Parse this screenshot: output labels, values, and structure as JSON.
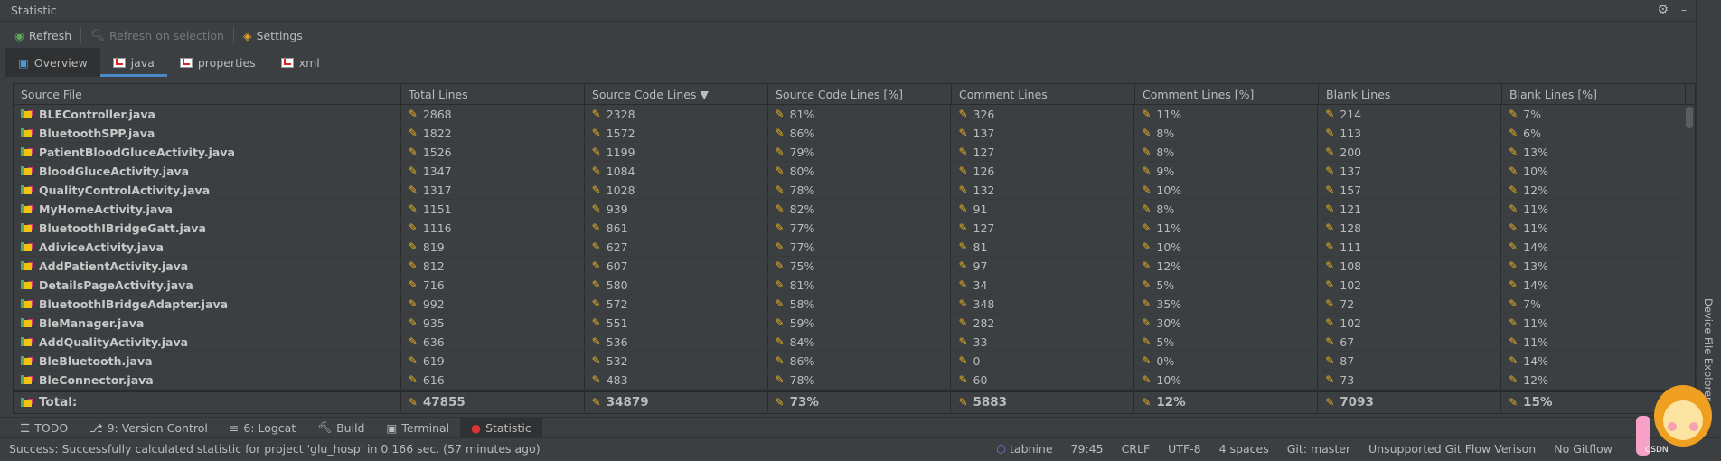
{
  "window": {
    "title": "Statistic"
  },
  "toolbar": {
    "refresh": "Refresh",
    "refresh_selection": "Refresh on selection",
    "settings": "Settings"
  },
  "tabs": [
    {
      "label": "Overview"
    },
    {
      "label": "java"
    },
    {
      "label": "properties"
    },
    {
      "label": "xml"
    }
  ],
  "table": {
    "columns": [
      "Source File",
      "Total Lines",
      "Source Code Lines ▼",
      "Source Code Lines [%]",
      "Comment Lines",
      "Comment Lines [%]",
      "Blank Lines",
      "Blank Lines [%]"
    ],
    "rows": [
      [
        "BLEController.java",
        "2868",
        "2328",
        "81%",
        "326",
        "11%",
        "214",
        "7%"
      ],
      [
        "BluetoothSPP.java",
        "1822",
        "1572",
        "86%",
        "137",
        "8%",
        "113",
        "6%"
      ],
      [
        "PatientBloodGluceActivity.java",
        "1526",
        "1199",
        "79%",
        "127",
        "8%",
        "200",
        "13%"
      ],
      [
        "BloodGluceActivity.java",
        "1347",
        "1084",
        "80%",
        "126",
        "9%",
        "137",
        "10%"
      ],
      [
        "QualityControlActivity.java",
        "1317",
        "1028",
        "78%",
        "132",
        "10%",
        "157",
        "12%"
      ],
      [
        "MyHomeActivity.java",
        "1151",
        "939",
        "82%",
        "91",
        "8%",
        "121",
        "11%"
      ],
      [
        "BluetoothIBridgeGatt.java",
        "1116",
        "861",
        "77%",
        "127",
        "11%",
        "128",
        "11%"
      ],
      [
        "AdiviceActivity.java",
        "819",
        "627",
        "77%",
        "81",
        "10%",
        "111",
        "14%"
      ],
      [
        "AddPatientActivity.java",
        "812",
        "607",
        "75%",
        "97",
        "12%",
        "108",
        "13%"
      ],
      [
        "DetailsPageActivity.java",
        "716",
        "580",
        "81%",
        "34",
        "5%",
        "102",
        "14%"
      ],
      [
        "BluetoothIBridgeAdapter.java",
        "992",
        "572",
        "58%",
        "348",
        "35%",
        "72",
        "7%"
      ],
      [
        "BleManager.java",
        "935",
        "551",
        "59%",
        "282",
        "30%",
        "102",
        "11%"
      ],
      [
        "AddQualityActivity.java",
        "636",
        "536",
        "84%",
        "33",
        "5%",
        "67",
        "11%"
      ],
      [
        "BleBluetooth.java",
        "619",
        "532",
        "86%",
        "0",
        "0%",
        "87",
        "14%"
      ],
      [
        "BleConnector.java",
        "616",
        "483",
        "78%",
        "60",
        "10%",
        "73",
        "12%"
      ]
    ],
    "total": [
      "Total:",
      "47855",
      "34879",
      "73%",
      "5883",
      "12%",
      "7093",
      "15%"
    ]
  },
  "toolwindows": [
    {
      "label": "TODO"
    },
    {
      "label": "9: Version Control"
    },
    {
      "label": "6: Logcat"
    },
    {
      "label": "Build"
    },
    {
      "label": "Terminal"
    },
    {
      "label": "Statistic"
    }
  ],
  "status": {
    "message": "Success: Successfully calculated statistic for project 'glu_hosp' in 0.166 sec. (57 minutes ago)",
    "tabnine": "tabnine",
    "position": "79:45",
    "line_sep": "CRLF",
    "encoding": "UTF-8",
    "indent": "4 spaces",
    "git": "Git: master",
    "gitflow": "Unsupported Git Flow Verison",
    "gitflow2": "No Gitflow"
  },
  "side": {
    "device_explorer": "Device File Explorer"
  },
  "watermark": "CSDN @拉莫帅"
}
